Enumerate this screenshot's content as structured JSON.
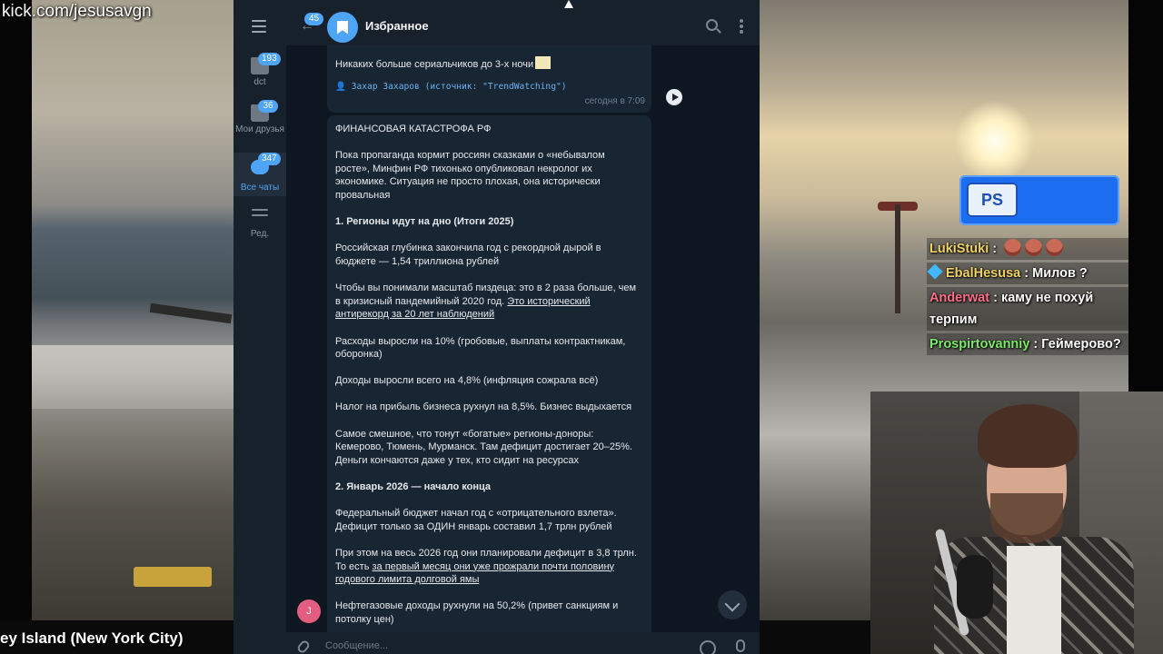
{
  "stream": {
    "watermark": "kick.com/jesusavgn",
    "location": "ey Island (New York City)"
  },
  "ps_badge": {
    "logo": "PS"
  },
  "stream_chat": [
    {
      "user": "LukiStuki",
      "user_color": "#f0d264",
      "message": "",
      "emotes": 3,
      "badge": ""
    },
    {
      "user": "EbalHesusa",
      "user_color": "#f0d264",
      "message": "Милов ?",
      "emotes": 0,
      "badge": "gem-icon"
    },
    {
      "user": "Anderwat",
      "user_color": "#ff6e8a",
      "message": "каму не похуй терпим",
      "emotes": 0,
      "badge": ""
    },
    {
      "user": "Prospirtovanniy",
      "user_color": "#7ee86a",
      "message": "Геймерово?",
      "emotes": 0,
      "badge": ""
    }
  ],
  "telegram": {
    "header": {
      "unread_count": "45",
      "title": "Избранное"
    },
    "folders": [
      {
        "label": "dct",
        "badge": "193"
      },
      {
        "label": "Мои друзья",
        "badge": "36"
      },
      {
        "label": "Все чаты",
        "badge": "347"
      },
      {
        "label": "Ред.",
        "badge": ""
      }
    ],
    "message1": {
      "text": "Никаких больше сериальчиков до 3-х ночи",
      "signature": "👤 Захар Захаров (источник: \"TrendWatching\")",
      "time": "сегодня в 7:09"
    },
    "message2": {
      "title": "ФИНАНСОВАЯ КАТАСТРОФА РФ",
      "p1": [
        "Пока пропаганда кормит россиян сказками о «небывалом",
        "росте», Минфин РФ тихонько опубликовал некролог их",
        "экономике. Ситуация не просто плохая, она исторически",
        "провальная"
      ],
      "h1": "1. Регионы идут на дно (Итоги 2025)",
      "p2": [
        "Российская глубинка закончила год с рекордной дырой в",
        "бюджете — 1,54 триллиона рублей"
      ],
      "p3_pre": [
        "Чтобы вы понимали масштаб пиздеца: это в 2 раза больше, чем",
        "в кризисный пандемийный 2020 год. "
      ],
      "p3_link1": "Это исторический",
      "p3_link2": "антирекорд за 20 лет наблюдений",
      "p4": [
        "Расходы выросли на 10% (гробовые, выплаты контрактникам,",
        "оборонка)"
      ],
      "p5": "Доходы выросли всего на 4,8% (инфляция сожрала всё)",
      "p6": "Налог на прибыль бизнеса рухнул на 8,5%. Бизнес выдыхается",
      "p7": [
        "Самое смешное, что тонут «богатые» регионы-доноры:",
        "Кемерово, Тюмень, Мурманск. Там дефицит достигает 20–25%.",
        "Деньги кончаются даже у тех, кто сидит на ресурсах"
      ],
      "h2": "2. Январь 2026 — начало конца",
      "p8": [
        "Федеральный бюджет начал год с «отрицательного взлета».",
        "Дефицит только за ОДИН январь составил 1,7 трлн рублей"
      ],
      "p9_line1": "При этом на весь 2026 год они планировали дефицит в 3,8 трлн.",
      "p9_pre": "То есть ",
      "p9_link1": "за первый месяц они уже прожрали почти половину",
      "p9_link2": "годового лимита долговой ямы",
      "p10": [
        "Нефтегазовые доходы рухнули на 50,2% (привет санкциям и",
        "потолку цен)"
      ]
    },
    "sender_initial": "J",
    "composer": {
      "placeholder": "Сообщение..."
    }
  }
}
